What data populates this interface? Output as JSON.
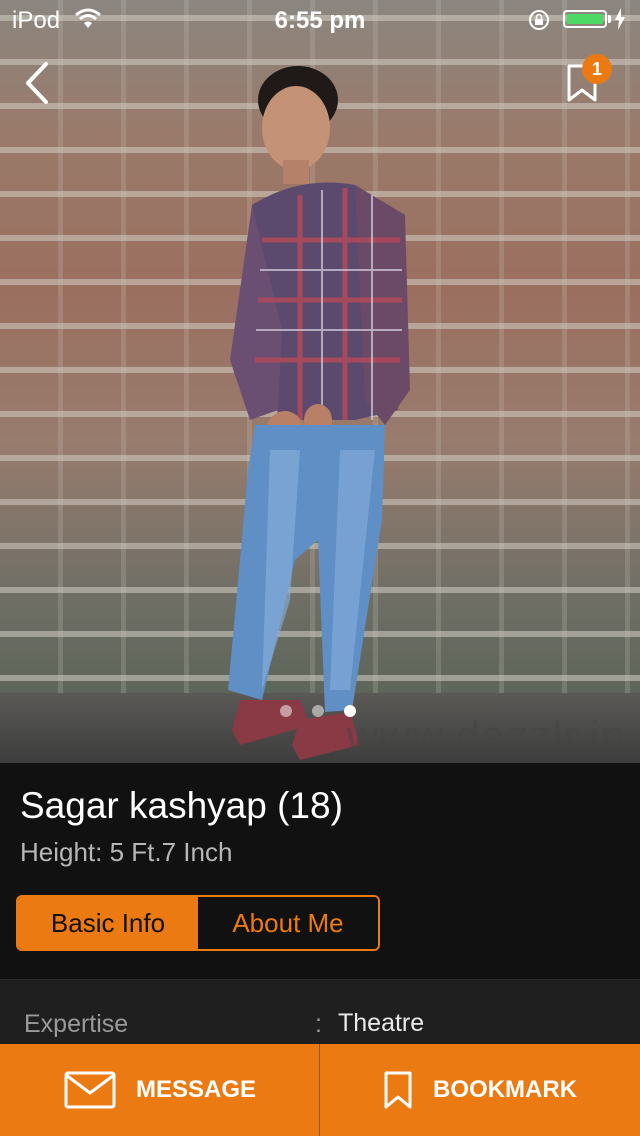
{
  "status_bar": {
    "carrier": "iPod",
    "time": "6:55 pm",
    "battery_level": 1.0
  },
  "nav": {
    "back_icon": "chevron-left-icon",
    "bookmark_icon": "bookmark-icon",
    "bookmark_badge": "1"
  },
  "photo": {
    "watermark": "www.dazzlr.in",
    "page_count": 3,
    "active_page": 3
  },
  "profile": {
    "name": "Sagar kashyap (18)",
    "height": "Height: 5 Ft.7 Inch"
  },
  "tabs": [
    {
      "label": "Basic Info",
      "active": true
    },
    {
      "label": "About Me",
      "active": false
    }
  ],
  "details": {
    "label": "Expertise",
    "separator": ":",
    "value": "Theatre"
  },
  "actions": {
    "message_label": "MESSAGE",
    "bookmark_label": "BOOKMARK"
  },
  "colors": {
    "accent": "#ec7a12",
    "background": "#111111",
    "battery": "#4cd964"
  }
}
